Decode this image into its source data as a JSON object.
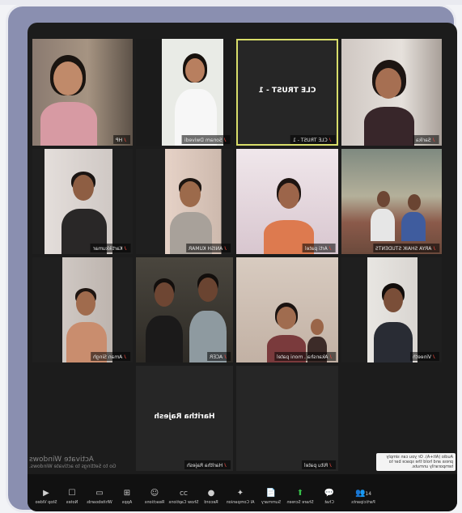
{
  "tiles": [
    {
      "name": "HP"
    },
    {
      "name": "Sonam Dwivedi"
    },
    {
      "name": "CLE TRUST - 1",
      "display": "CLE TRUST - 1"
    },
    {
      "name": "Sarika"
    },
    {
      "name": "Kartikkumar"
    },
    {
      "name": "ANISH KUMAR"
    },
    {
      "name": "Arti patel"
    },
    {
      "name": "ARYA SHAIK STUDENTS"
    },
    {
      "name": "Aman Singh"
    },
    {
      "name": "ACER"
    },
    {
      "name": "Akansha . moni patel"
    },
    {
      "name": "Vineeth"
    },
    {
      "name": "Haritha Rajesh",
      "display": "Haritha Rajesh"
    },
    {
      "name": "Ritu patel"
    }
  ],
  "toolbar": [
    {
      "label": "Participants",
      "icon": "participants-icon",
      "glyph": "👥",
      "badge": "14"
    },
    {
      "label": "Chat",
      "icon": "chat-icon",
      "glyph": "💬"
    },
    {
      "label": "Share Screen",
      "icon": "share-screen-icon",
      "glyph": "⬆"
    },
    {
      "label": "Summary",
      "icon": "summary-icon",
      "glyph": "📄"
    },
    {
      "label": "AI Companion",
      "icon": "ai-companion-icon",
      "glyph": "✦"
    },
    {
      "label": "Record",
      "icon": "record-icon",
      "glyph": "●"
    },
    {
      "label": "Show Captions",
      "icon": "captions-icon",
      "glyph": "CC"
    },
    {
      "label": "Reactions",
      "icon": "reactions-icon",
      "glyph": "☺"
    },
    {
      "label": "Apps",
      "icon": "apps-icon",
      "glyph": "⊞"
    },
    {
      "label": "Whiteboards",
      "icon": "whiteboard-icon",
      "glyph": "▭"
    },
    {
      "label": "Notes",
      "icon": "notes-icon",
      "glyph": "☐"
    }
  ],
  "left_controls": [
    {
      "label": "Stop Video",
      "icon": "video-icon",
      "glyph": "▶"
    }
  ],
  "watermark": {
    "line1": "Activate Windows",
    "line2": "Go to Settings to activate Windows."
  },
  "tip": {
    "text": "Audio (Alt+A). Or you can simply press and hold the space bar to temporarily unmute."
  },
  "colors": {
    "toolbar_bg": "#111111",
    "highlight": "#d8dd6a",
    "mic_muted": "#e0443b",
    "share_green": "#37c04a"
  }
}
